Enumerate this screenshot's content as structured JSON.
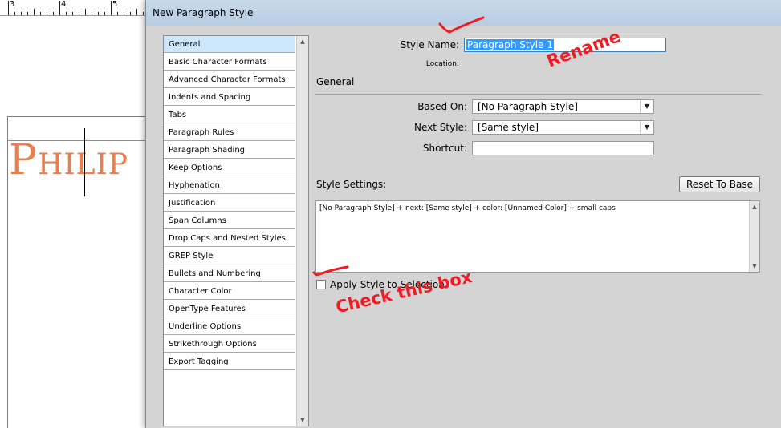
{
  "document": {
    "ruler_labels": [
      "3",
      "4",
      "5"
    ],
    "text": "Philip",
    "text_color": "#e97f4f"
  },
  "dialog": {
    "title": "New Paragraph Style",
    "categories": [
      {
        "label": "General",
        "selected": true
      },
      {
        "label": "Basic Character Formats"
      },
      {
        "label": "Advanced Character Formats"
      },
      {
        "label": "Indents and Spacing"
      },
      {
        "label": "Tabs"
      },
      {
        "label": "Paragraph Rules"
      },
      {
        "label": "Paragraph Shading"
      },
      {
        "label": "Keep Options"
      },
      {
        "label": "Hyphenation"
      },
      {
        "label": "Justification"
      },
      {
        "label": "Span Columns"
      },
      {
        "label": "Drop Caps and Nested Styles"
      },
      {
        "label": "GREP Style"
      },
      {
        "label": "Bullets and Numbering"
      },
      {
        "label": "Character Color"
      },
      {
        "label": "OpenType Features"
      },
      {
        "label": "Underline Options"
      },
      {
        "label": "Strikethrough Options"
      },
      {
        "label": "Export Tagging"
      }
    ],
    "style_name_label": "Style Name:",
    "style_name_value": "Paragraph Style 1",
    "location_label": "Location:",
    "section_title": "General",
    "based_on_label": "Based On:",
    "based_on_value": "[No Paragraph Style]",
    "next_style_label": "Next Style:",
    "next_style_value": "[Same style]",
    "shortcut_label": "Shortcut:",
    "shortcut_value": "",
    "style_settings_label": "Style Settings:",
    "reset_button_label": "Reset To Base",
    "style_settings_text": "[No Paragraph Style] + next: [Same style] + color: [Unnamed Color] + small caps",
    "apply_checkbox_label": "Apply Style to Selection",
    "apply_checkbox_checked": false
  },
  "annotations": {
    "rename": "Rename",
    "check": "Check this box",
    "color": "#ee1c24"
  }
}
